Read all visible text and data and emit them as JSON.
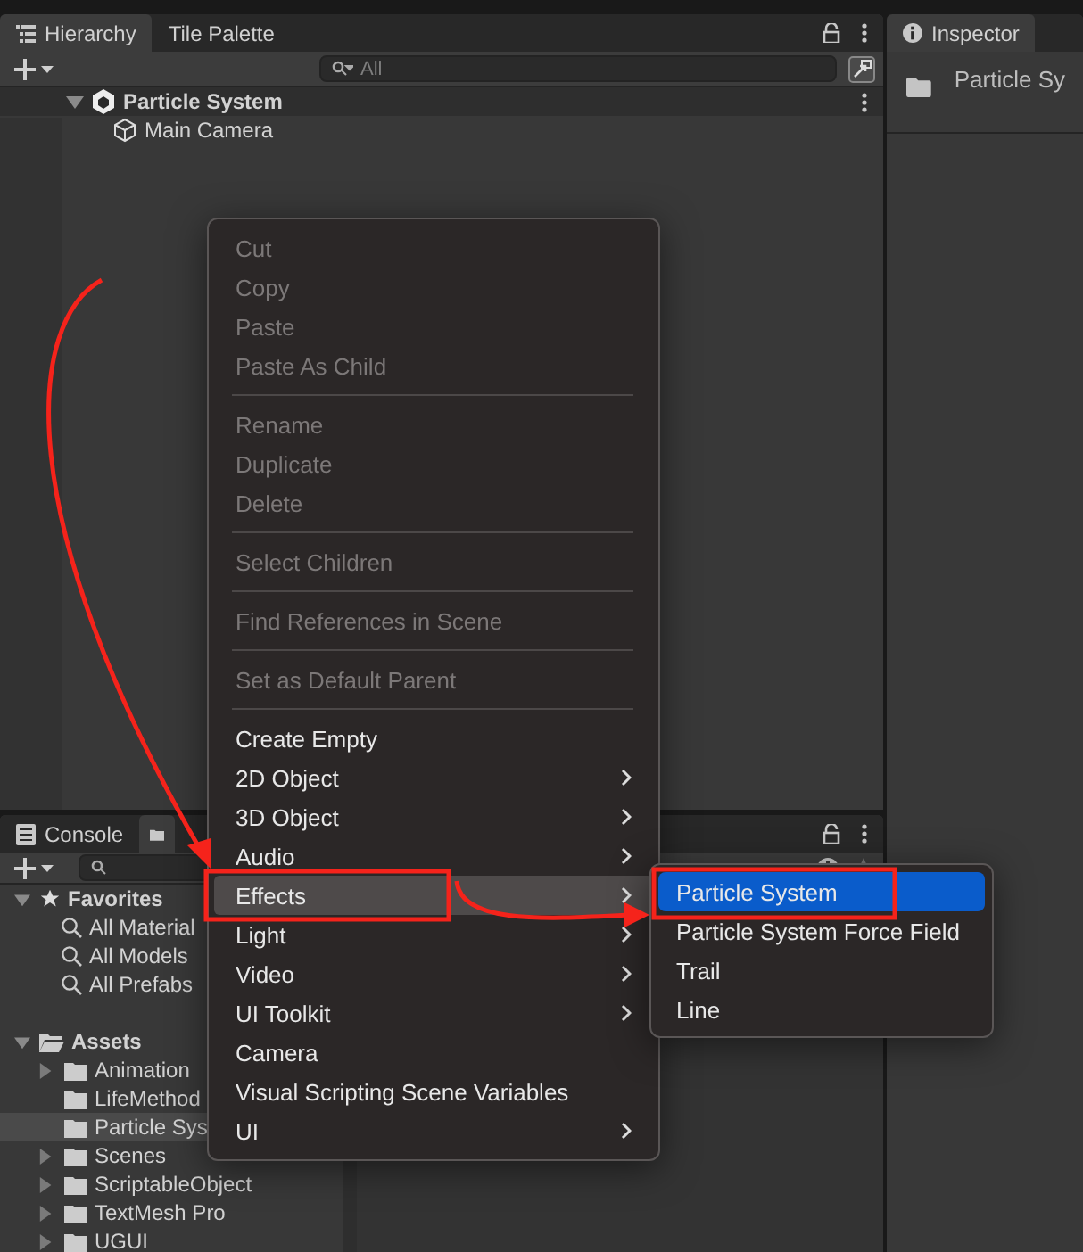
{
  "hierarchy": {
    "tabs": [
      {
        "label": "Hierarchy",
        "selected": true
      },
      {
        "label": "Tile Palette",
        "selected": false
      }
    ],
    "search": {
      "placeholder": "All"
    },
    "items": [
      {
        "label": "Particle System",
        "kind": "scene",
        "expanded": true,
        "children": [
          {
            "label": "Main Camera",
            "kind": "gameobject"
          }
        ]
      }
    ]
  },
  "inspector": {
    "tab": "Inspector",
    "title": "Particle Sy"
  },
  "project": {
    "tabs": [
      {
        "label": "Console",
        "selected": false
      }
    ],
    "favorites": {
      "label": "Favorites",
      "expanded": true,
      "items": [
        "All Material",
        "All Models",
        "All Prefabs"
      ]
    },
    "assets": {
      "label": "Assets",
      "expanded": true,
      "children": [
        {
          "label": "Animation",
          "has_children": true,
          "selected": false
        },
        {
          "label": "LifeMethod",
          "has_children": false,
          "selected": false
        },
        {
          "label": "Particle Sys",
          "has_children": false,
          "selected": true
        },
        {
          "label": "Scenes",
          "has_children": true,
          "selected": false
        },
        {
          "label": "ScriptableObject",
          "has_children": true,
          "selected": false
        },
        {
          "label": "TextMesh Pro",
          "has_children": true,
          "selected": false
        },
        {
          "label": "UGUI",
          "has_children": true,
          "selected": false
        }
      ]
    }
  },
  "context_menu": {
    "items": [
      {
        "kind": "item",
        "label": "Cut",
        "disabled": true,
        "submenu": false,
        "selected": false
      },
      {
        "kind": "item",
        "label": "Copy",
        "disabled": true,
        "submenu": false,
        "selected": false
      },
      {
        "kind": "item",
        "label": "Paste",
        "disabled": true,
        "submenu": false,
        "selected": false
      },
      {
        "kind": "item",
        "label": "Paste As Child",
        "disabled": true,
        "submenu": false,
        "selected": false
      },
      {
        "kind": "separator"
      },
      {
        "kind": "item",
        "label": "Rename",
        "disabled": true,
        "submenu": false,
        "selected": false
      },
      {
        "kind": "item",
        "label": "Duplicate",
        "disabled": true,
        "submenu": false,
        "selected": false
      },
      {
        "kind": "item",
        "label": "Delete",
        "disabled": true,
        "submenu": false,
        "selected": false
      },
      {
        "kind": "separator"
      },
      {
        "kind": "item",
        "label": "Select Children",
        "disabled": true,
        "submenu": false,
        "selected": false
      },
      {
        "kind": "separator"
      },
      {
        "kind": "item",
        "label": "Find References in Scene",
        "disabled": true,
        "submenu": false,
        "selected": false
      },
      {
        "kind": "separator"
      },
      {
        "kind": "item",
        "label": "Set as Default Parent",
        "disabled": true,
        "submenu": false,
        "selected": false
      },
      {
        "kind": "separator"
      },
      {
        "kind": "item",
        "label": "Create Empty",
        "disabled": false,
        "submenu": false,
        "selected": false
      },
      {
        "kind": "item",
        "label": "2D Object",
        "disabled": false,
        "submenu": true,
        "selected": false
      },
      {
        "kind": "item",
        "label": "3D Object",
        "disabled": false,
        "submenu": true,
        "selected": false
      },
      {
        "kind": "item",
        "label": "Audio",
        "disabled": false,
        "submenu": true,
        "selected": false
      },
      {
        "kind": "item",
        "label": "Effects",
        "disabled": false,
        "submenu": true,
        "selected": true
      },
      {
        "kind": "item",
        "label": "Light",
        "disabled": false,
        "submenu": true,
        "selected": false
      },
      {
        "kind": "item",
        "label": "Video",
        "disabled": false,
        "submenu": true,
        "selected": false
      },
      {
        "kind": "item",
        "label": "UI Toolkit",
        "disabled": false,
        "submenu": true,
        "selected": false
      },
      {
        "kind": "item",
        "label": "Camera",
        "disabled": false,
        "submenu": false,
        "selected": false
      },
      {
        "kind": "item",
        "label": "Visual Scripting Scene Variables",
        "disabled": false,
        "submenu": false,
        "selected": false
      },
      {
        "kind": "item",
        "label": "UI",
        "disabled": false,
        "submenu": true,
        "selected": false
      }
    ]
  },
  "submenu": {
    "items": [
      {
        "label": "Particle System",
        "selected": true
      },
      {
        "label": "Particle System Force Field",
        "selected": false
      },
      {
        "label": "Trail",
        "selected": false
      },
      {
        "label": "Line",
        "selected": false
      }
    ]
  }
}
